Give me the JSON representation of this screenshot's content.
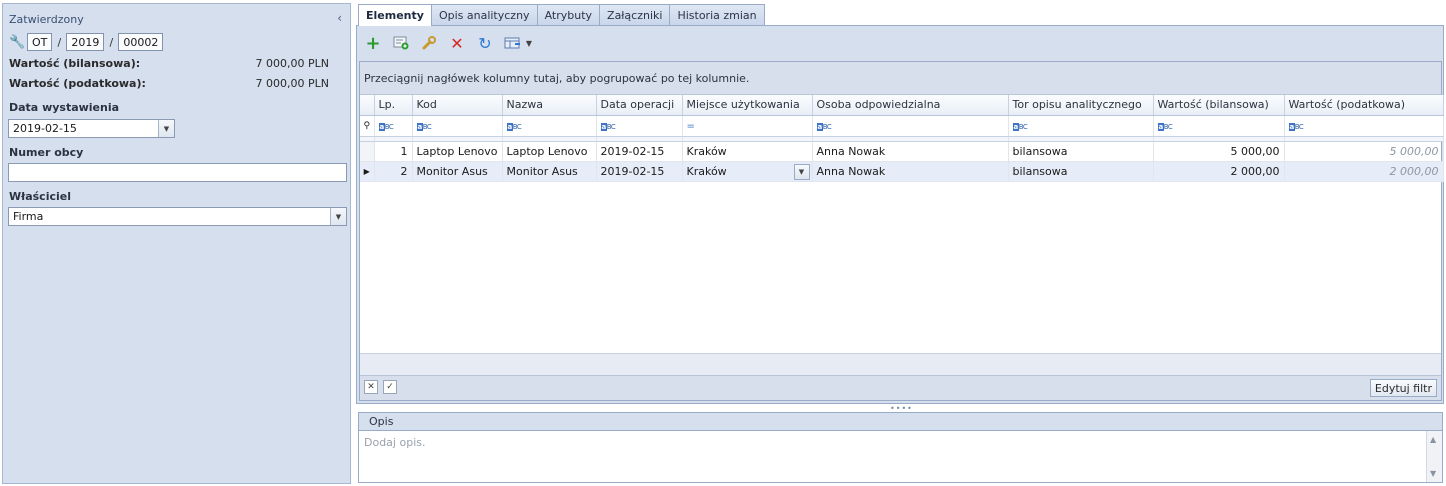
{
  "left_panel": {
    "status": "Zatwierdzony",
    "collapse_icon": "chevron-left-icon",
    "number": {
      "prefix": "OT",
      "year": "2019",
      "seq": "00002",
      "sep": "/"
    },
    "values": [
      {
        "label": "Wartość (bilansowa):",
        "amount": "7 000,00 PLN"
      },
      {
        "label": "Wartość (podatkowa):",
        "amount": "7 000,00 PLN"
      }
    ],
    "issue_date_label": "Data wystawienia",
    "issue_date": "2019-02-15",
    "foreign_number_label": "Numer obcy",
    "foreign_number": "",
    "owner_label": "Właściciel",
    "owner": "Firma"
  },
  "tabs": [
    "Elementy",
    "Opis analityczny",
    "Atrybuty",
    "Załączniki",
    "Historia zmian"
  ],
  "active_tab": 0,
  "toolbar": {
    "icons": [
      "add-icon",
      "add-from-list-icon",
      "edit-icon",
      "delete-icon",
      "refresh-icon",
      "export-icon",
      "dropdown-arrow-icon"
    ],
    "colors": {
      "add": "#2e9b2e",
      "delete": "#d42a1f",
      "refresh": "#2c7ad6"
    }
  },
  "grid": {
    "group_hint": "Przeciągnij nagłówek kolumny tutaj, aby pogrupować po tej kolumnie.",
    "columns": [
      "Lp.",
      "Kod",
      "Nazwa",
      "Data operacji",
      "Miejsce użytkowania",
      "Osoba odpowiedzialna",
      "Tor opisu analitycznego",
      "Wartość (bilansowa)",
      "Wartość (podatkowa)"
    ],
    "rows": [
      {
        "lp": "1",
        "kod": "Laptop Lenovo",
        "nazwa": "Laptop Lenovo",
        "data": "2019-02-15",
        "miejsce": "Kraków",
        "osoba": "Anna Nowak",
        "tor": "bilansowa",
        "wb": "5 000,00",
        "wp": "5 000,00"
      },
      {
        "lp": "2",
        "kod": "Monitor Asus",
        "nazwa": "Monitor Asus",
        "data": "2019-02-15",
        "miejsce": "Kraków",
        "osoba": "Anna Nowak",
        "tor": "bilansowa",
        "wb": "2 000,00",
        "wp": "2 000,00"
      }
    ],
    "selected_row": 1,
    "edit_filter_label": "Edytuj filtr"
  },
  "opis": {
    "tab_label": "Opis",
    "placeholder": "Dodaj opis."
  }
}
